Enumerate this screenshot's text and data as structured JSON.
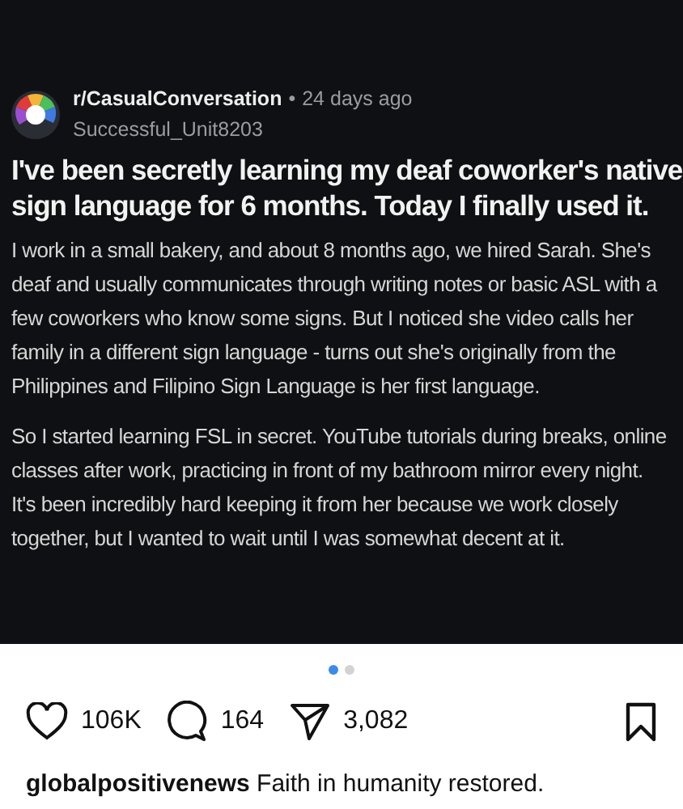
{
  "post_image": {
    "subreddit": "r/CasualConversation",
    "separator": "•",
    "time": "24 days ago",
    "author": "Successful_Unit8203",
    "title": [
      "I've been secretly learning my deaf coworker's native",
      "sign language for 6 months. Today I finally used it."
    ],
    "paragraphs": [
      [
        "I work in a small bakery, and about 8 months ago, we hired Sarah. She's",
        "deaf and usually communicates through writing notes or basic ASL with a",
        "few coworkers who know some signs. But I noticed she video calls her",
        "family in a different sign language - turns out she's originally from the",
        "Philippines and Filipino Sign Language is her first language."
      ],
      [
        "So I started learning FSL in secret. YouTube tutorials during breaks, online",
        "classes after work, practicing in front of my bathroom mirror every night.",
        "It's been incredibly hard keeping it from her because we work closely",
        "together, but I wanted to wait until I was somewhat decent at it."
      ]
    ]
  },
  "carousel_dots": [
    {
      "selected": true
    },
    {
      "selected": false
    }
  ],
  "actions": {
    "likes": "106K",
    "comments": "164",
    "shares": "3,082"
  },
  "caption": {
    "username": "globalpositivenews",
    "text": "Faith in humanity restored."
  }
}
